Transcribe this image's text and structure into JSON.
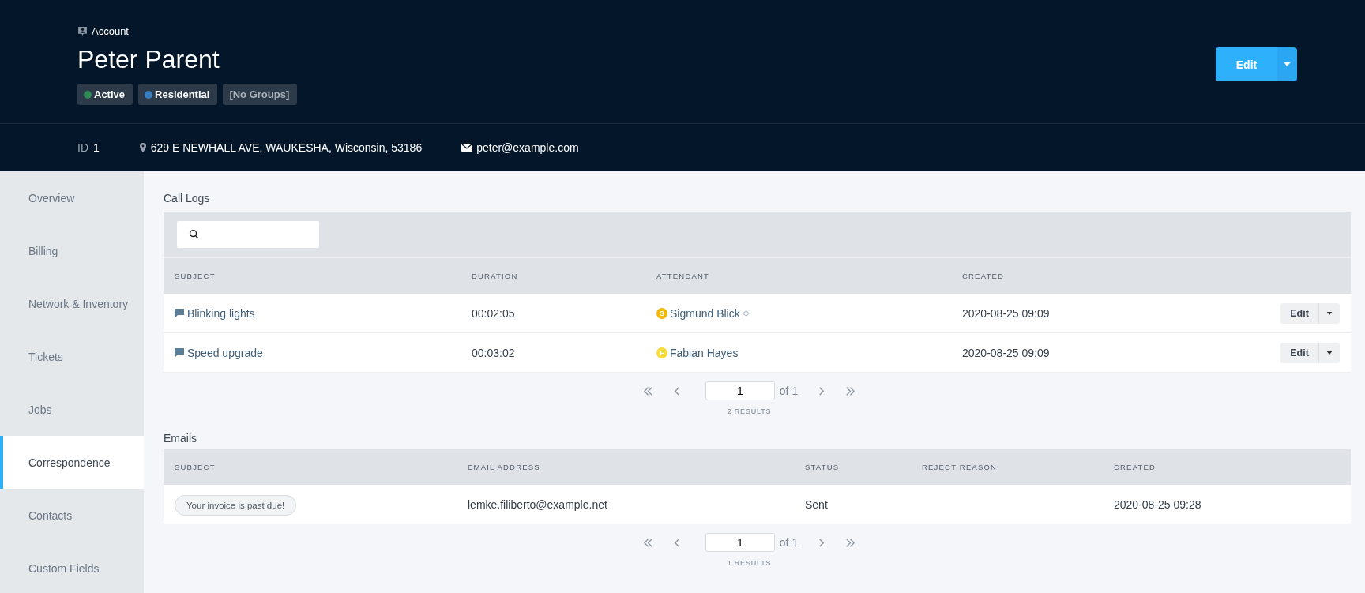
{
  "header": {
    "breadcrumb": "Account",
    "title": "Peter Parent",
    "tags": [
      {
        "label": "Active",
        "color": "#2e8b57",
        "muted": false
      },
      {
        "label": "Residential",
        "color": "#3a7fc1",
        "muted": false
      },
      {
        "label": "[No Groups]",
        "muted": true
      }
    ],
    "edit_button": "Edit"
  },
  "info_bar": {
    "id_label": "ID",
    "id_value": "1",
    "address": "629 E NEWHALL AVE, WAUKESHA, Wisconsin, 53186",
    "email": "peter@example.com"
  },
  "sidebar": {
    "items": [
      {
        "label": "Overview",
        "selected": false
      },
      {
        "label": "Billing",
        "selected": false
      },
      {
        "label": "Network & Inventory",
        "selected": false
      },
      {
        "label": "Tickets",
        "selected": false
      },
      {
        "label": "Jobs",
        "selected": false
      },
      {
        "label": "Correspondence",
        "selected": true
      },
      {
        "label": "Contacts",
        "selected": false
      },
      {
        "label": "Custom Fields",
        "selected": false
      }
    ]
  },
  "call_logs": {
    "title": "Call Logs",
    "columns": [
      "SUBJECT",
      "DURATION",
      "ATTENDANT",
      "CREATED"
    ],
    "rows": [
      {
        "subject": "Blinking lights",
        "duration": "00:02:05",
        "attendant_initial": "S",
        "color": "#f5b800",
        "attendant": "Sigmund Blick",
        "linked": true,
        "created": "2020-08-25 09:09",
        "action": "Edit"
      },
      {
        "subject": "Speed upgrade",
        "duration": "00:03:02",
        "attendant_initial": "F",
        "color": "#f9dc3a",
        "attendant": "Fabian Hayes",
        "linked": false,
        "created": "2020-08-25 09:09",
        "action": "Edit"
      }
    ],
    "pagination": {
      "page": "1",
      "of": "of 1",
      "results": "2 RESULTS"
    }
  },
  "emails": {
    "title": "Emails",
    "columns": [
      "SUBJECT",
      "EMAIL ADDRESS",
      "STATUS",
      "REJECT REASON",
      "CREATED"
    ],
    "rows": [
      {
        "subject": "Your invoice is past due!",
        "address": "lemke.filiberto@example.net",
        "status": "Sent",
        "created": "2020-08-25 09:28"
      }
    ],
    "pagination": {
      "page": "1",
      "of": "of 1",
      "results": "1 RESULTS"
    }
  }
}
